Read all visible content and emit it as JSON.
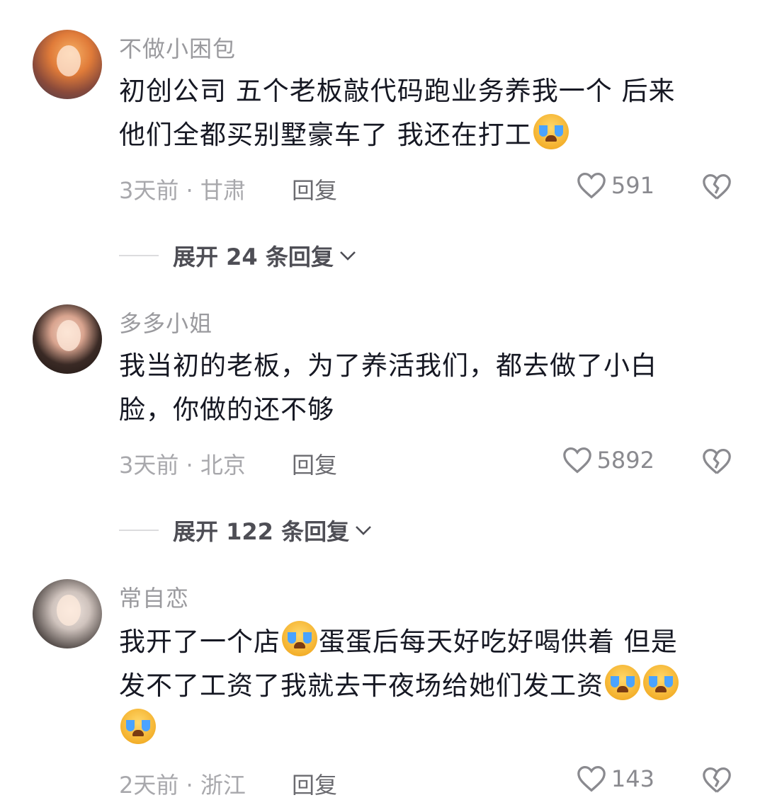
{
  "comments": [
    {
      "username": "不做小困包",
      "text_parts": [
        "初创公司 五个老板敲代码跑业务养我一个 后来",
        "他们全都买别墅豪车了 我还在打工"
      ],
      "time": "3天前 · 甘肃",
      "reply_label": "回复",
      "likes": "591",
      "expand_label": "展开 24 条回复"
    },
    {
      "username": "多多小姐",
      "text_parts": [
        "我当初的老板，为了养活我们，都去做了小白",
        "脸，你做的还不够"
      ],
      "time": "3天前 · 北京",
      "reply_label": "回复",
      "likes": "5892",
      "expand_label": "展开 122 条回复"
    },
    {
      "username": "常自恋",
      "text_parts": [
        "我开了一个店",
        "蛋蛋后每天好吃好喝供着 但是",
        "发不了工资了我就去干夜场给她们发工资"
      ],
      "time": "2天前 · 浙江",
      "reply_label": "回复",
      "likes": "143"
    }
  ],
  "icons": {
    "like": "heart-outline-icon",
    "dislike": "broken-heart-icon",
    "emoji": "crying-face-emoji"
  }
}
